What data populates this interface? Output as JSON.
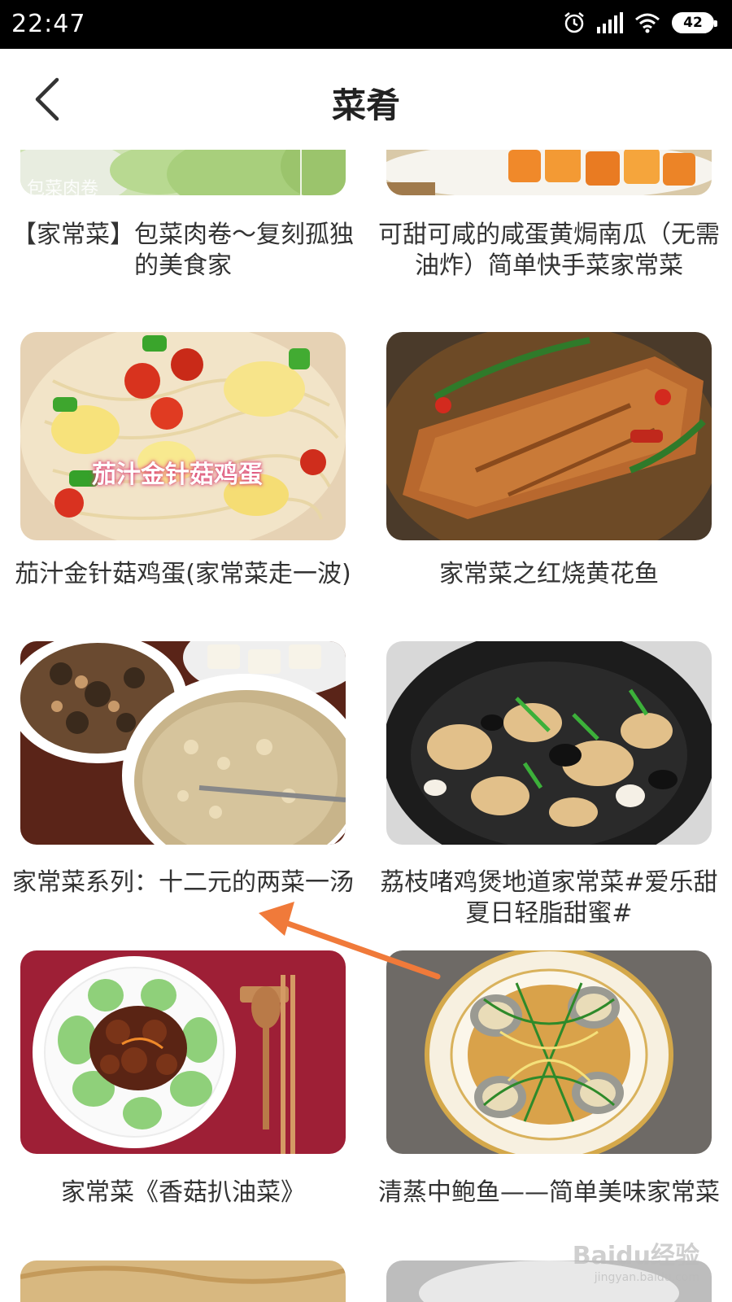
{
  "status": {
    "time": "22:47",
    "battery": "42"
  },
  "header": {
    "title": "菜肴"
  },
  "recipes": [
    {
      "title": "【家常菜】包菜肉卷～复刻孤独的美食家",
      "image_caption": "包菜肉卷"
    },
    {
      "title": "可甜可咸的咸蛋黄焗南瓜（无需油炸）简单快手菜家常菜"
    },
    {
      "title": "茄汁金针菇鸡蛋(家常菜走一波)",
      "image_caption": "茄汁金针菇鸡蛋"
    },
    {
      "title": "家常菜之红烧黄花鱼"
    },
    {
      "title": "家常菜系列：十二元的两菜一汤"
    },
    {
      "title": "荔枝啫鸡煲地道家常菜#爱乐甜夏日轻脂甜蜜#"
    },
    {
      "title": "家常菜《香菇扒油菜》"
    },
    {
      "title": "清蒸中鲍鱼——简单美味家常菜"
    }
  ],
  "watermark": {
    "text": "Baidu经验",
    "url": "jingyan.baidu.com"
  },
  "colors": {
    "accent_arrow": "#f07a3a"
  }
}
